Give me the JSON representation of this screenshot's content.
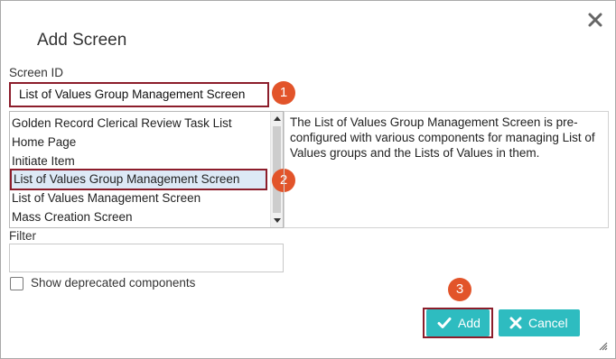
{
  "dialog": {
    "title": "Add Screen"
  },
  "screen_id": {
    "label": "Screen ID",
    "value": "List of Values Group Management Screen"
  },
  "screen_list": {
    "items": [
      "Golden Record Clerical Review Task List",
      "Home Page",
      "Initiate Item",
      "List of Values Group Management Screen",
      "List of Values Management Screen",
      "Mass Creation Screen"
    ],
    "selected_index": 3
  },
  "description": "The List of Values Group Management Screen is pre-configured with various components for managing List of Values groups and the Lists of Values in them.",
  "filter": {
    "label": "Filter",
    "value": ""
  },
  "show_deprecated": {
    "label": "Show deprecated components",
    "checked": false
  },
  "buttons": {
    "add_label": "Add",
    "cancel_label": "Cancel"
  },
  "callouts": [
    "1",
    "2",
    "3"
  ],
  "colors": {
    "button_teal": "#2ebcc0",
    "callout_orange": "#e2542a",
    "highlight_maroon": "#8c1d2b",
    "selected_row": "#dde9f6"
  },
  "icons": {
    "close": "close-icon",
    "add": "checkmark-icon",
    "cancel": "x-icon",
    "resize": "resize-grip-icon"
  }
}
